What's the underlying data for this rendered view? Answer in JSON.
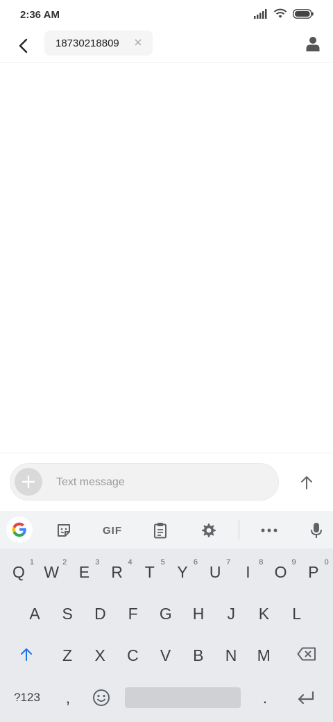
{
  "status_bar": {
    "time": "2:36 AM"
  },
  "header": {
    "recipient": "18730218809"
  },
  "compose": {
    "placeholder": "Text message"
  },
  "keyboard": {
    "toolbar": {
      "gif_label": "GIF"
    },
    "row1": [
      {
        "key": "Q",
        "hint": "1"
      },
      {
        "key": "W",
        "hint": "2"
      },
      {
        "key": "E",
        "hint": "3"
      },
      {
        "key": "R",
        "hint": "4"
      },
      {
        "key": "T",
        "hint": "5"
      },
      {
        "key": "Y",
        "hint": "6"
      },
      {
        "key": "U",
        "hint": "7"
      },
      {
        "key": "I",
        "hint": "8"
      },
      {
        "key": "O",
        "hint": "9"
      },
      {
        "key": "P",
        "hint": "0"
      }
    ],
    "row2": [
      "A",
      "S",
      "D",
      "F",
      "G",
      "H",
      "J",
      "K",
      "L"
    ],
    "row3": [
      "Z",
      "X",
      "C",
      "V",
      "B",
      "N",
      "M"
    ],
    "row4": {
      "symbols": "?123",
      "comma": ",",
      "period": "."
    }
  }
}
